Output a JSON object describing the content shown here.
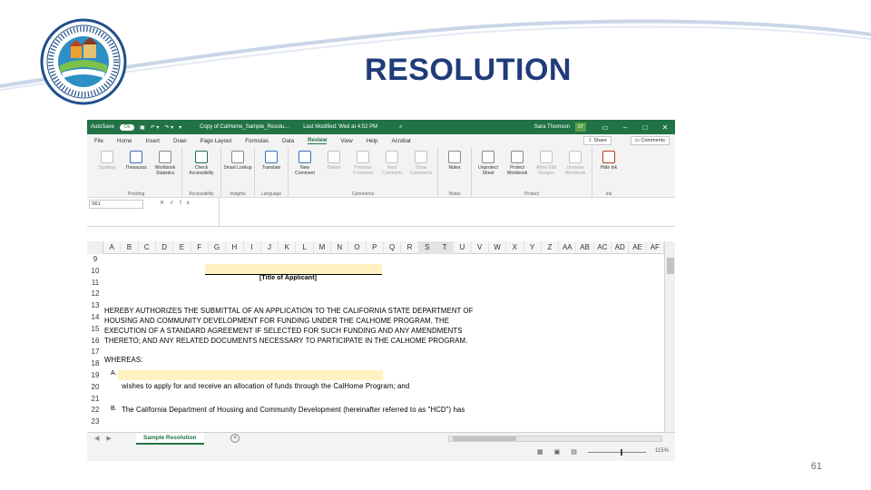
{
  "slide": {
    "title": "RESOLUTION",
    "page_number": "61",
    "seal_text": "HOUSING AND COMMUNITY DEVELOPMENT · CALIFORNIA ·"
  },
  "excel": {
    "titlebar": {
      "autosave": "AutoSave",
      "toggle": "On",
      "filename": "Copy of CalHome_Sample_Resolu...",
      "last_modified": "Last Modified: Wed at 4:52 PM",
      "user_name": "Sara Thomson",
      "user_initials": "ST"
    },
    "menu": [
      "File",
      "Home",
      "Insert",
      "Draw",
      "Page Layout",
      "Formulas",
      "Data",
      "Review",
      "View",
      "Help",
      "Acrobat"
    ],
    "share_label": "Share",
    "comments_label": "Comments",
    "ribbon": [
      {
        "group": "Proofing",
        "buttons": [
          {
            "label": "Spelling",
            "icon": "spelling-icon",
            "dim": true
          },
          {
            "label": "Thesaurus",
            "icon": "thesaurus-icon",
            "dim": false
          },
          {
            "label": "Workbook Statistics",
            "icon": "workbook-statistics-icon",
            "dim": false
          }
        ]
      },
      {
        "group": "Accessibility",
        "buttons": [
          {
            "label": "Check Accessibility",
            "icon": "check-accessibility-icon",
            "dim": false
          }
        ]
      },
      {
        "group": "Insights",
        "buttons": [
          {
            "label": "Smart Lookup",
            "icon": "smart-lookup-icon",
            "dim": false
          }
        ]
      },
      {
        "group": "Language",
        "buttons": [
          {
            "label": "Translate",
            "icon": "translate-icon",
            "dim": false
          }
        ]
      },
      {
        "group": "Comments",
        "buttons": [
          {
            "label": "New Comment",
            "icon": "new-comment-icon",
            "dim": false
          },
          {
            "label": "Delete",
            "icon": "delete-comment-icon",
            "dim": true
          },
          {
            "label": "Previous Comment",
            "icon": "previous-comment-icon",
            "dim": true
          },
          {
            "label": "Next Comment",
            "icon": "next-comment-icon",
            "dim": true
          },
          {
            "label": "Show Comments",
            "icon": "show-comments-icon",
            "dim": true
          }
        ]
      },
      {
        "group": "Notes",
        "buttons": [
          {
            "label": "Notes",
            "icon": "notes-icon",
            "dim": false
          }
        ]
      },
      {
        "group": "Protect",
        "buttons": [
          {
            "label": "Unprotect Sheet",
            "icon": "unprotect-sheet-icon",
            "dim": false
          },
          {
            "label": "Protect Workbook",
            "icon": "protect-workbook-icon",
            "dim": false
          },
          {
            "label": "Allow Edit Ranges",
            "icon": "allow-edit-ranges-icon",
            "dim": true
          },
          {
            "label": "Unshare Workbook",
            "icon": "unshare-workbook-icon",
            "dim": true
          }
        ]
      },
      {
        "group": "Ink",
        "buttons": [
          {
            "label": "Hide Ink",
            "icon": "hide-ink-icon",
            "dim": false
          }
        ]
      }
    ],
    "namebox": "S61",
    "fx_label": "fx",
    "columns": [
      "A",
      "B",
      "C",
      "D",
      "E",
      "F",
      "G",
      "H",
      "I",
      "J",
      "K",
      "L",
      "M",
      "N",
      "O",
      "P",
      "Q",
      "R",
      "S",
      "T",
      "U",
      "V",
      "W",
      "X",
      "Y",
      "Z",
      "AA",
      "AB",
      "AC",
      "AD",
      "AE",
      "AF"
    ],
    "rows": [
      "9",
      "10",
      "11",
      "12",
      "13",
      "14",
      "15",
      "16",
      "17",
      "18",
      "19",
      "20",
      "21",
      "22",
      "23"
    ],
    "cells": {
      "title_of_applicant": "[Title of Applicant]",
      "authorize_line1": "HEREBY AUTHORIZES THE SUBMITTAL OF AN APPLICATION TO THE CALIFORNIA STATE DEPARTMENT OF",
      "authorize_line2": "HOUSING AND COMMUNITY DEVELOPMENT FOR FUNDING UNDER THE CALHOME PROGRAM, THE",
      "authorize_line3": "EXECUTION OF A STANDARD AGREEMENT IF SELECTED FOR SUCH FUNDING AND ANY AMENDMENTS",
      "authorize_line4": "THERETO; AND ANY RELATED DOCUMENTS NECESSARY TO PARTICIPATE IN THE CALHOME PROGRAM.",
      "whereas": "WHEREAS:",
      "item_a_letter": "A.",
      "item_a_text": "wishes to apply for and receive an allocation of funds through the CalHome Program; and",
      "item_b_letter": "B.",
      "item_b_text": "The California Department of Housing and Community Development  (hereinafter referred to as \"HCD\") has"
    },
    "sheet_tab": "Sample Resolution",
    "zoom": "115%"
  }
}
